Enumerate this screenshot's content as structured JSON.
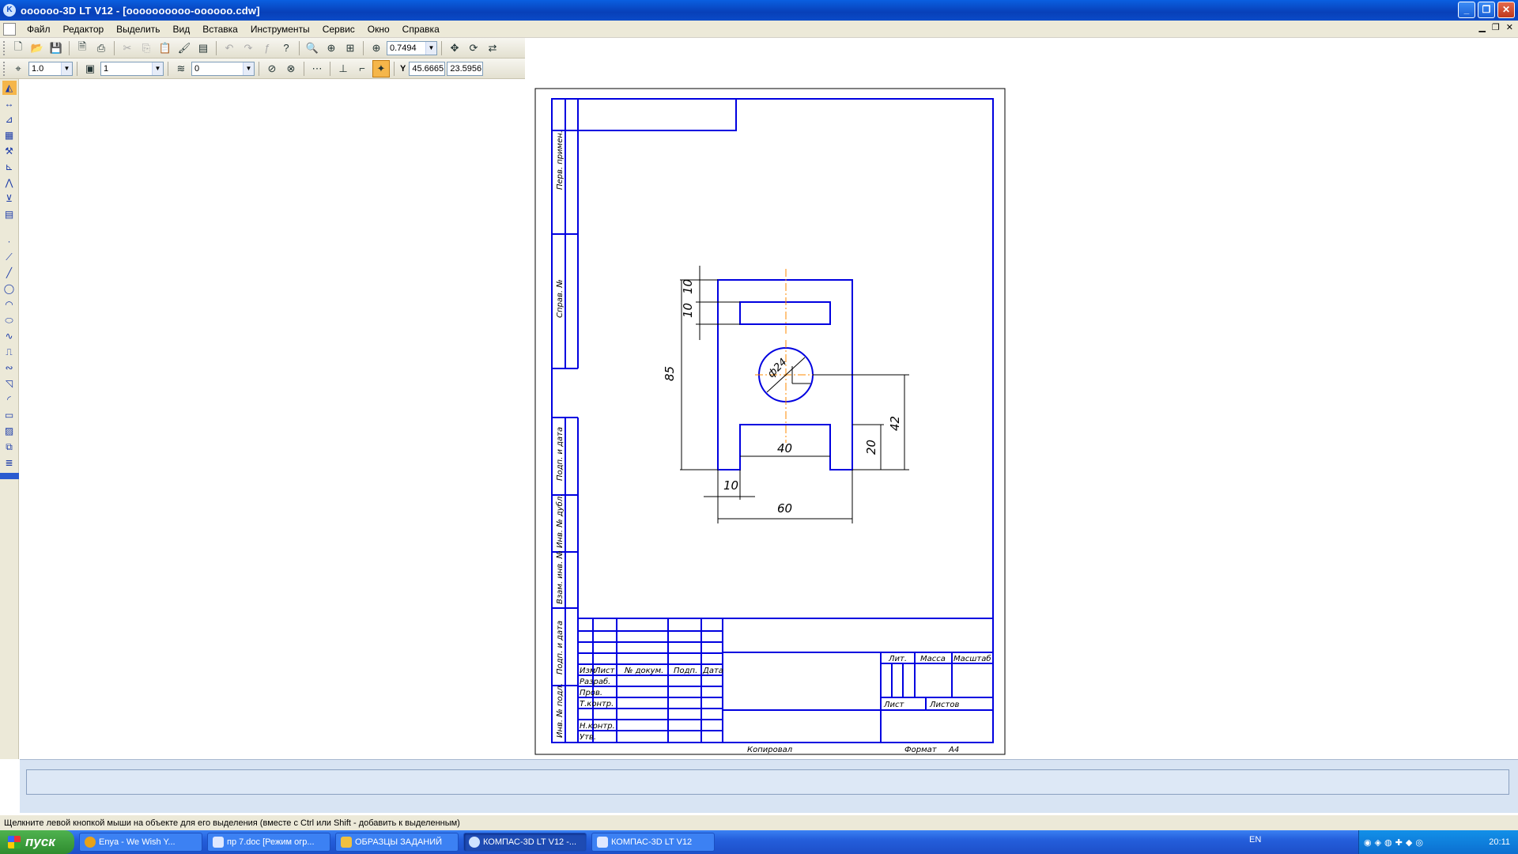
{
  "window": {
    "title": "oooooo-3D LT V12 - [oooooooooo-oooooo.cdw]"
  },
  "menu": [
    "Файл",
    "Редактор",
    "Выделить",
    "Вид",
    "Вставка",
    "Инструменты",
    "Сервис",
    "Окно",
    "Справка"
  ],
  "toolbar1": {
    "zoom": "0.7494"
  },
  "toolbar2": {
    "step": "1.0",
    "layer": "1",
    "style": "0",
    "coord_x": "45.6665",
    "coord_y": "23.5956",
    "coord_label": "Y"
  },
  "drawing": {
    "dims": {
      "d10a": "10",
      "d10b": "10",
      "d85": "85",
      "d42": "42",
      "d20": "20",
      "d40": "40",
      "d10c": "10",
      "d60": "60",
      "phi": "ф24"
    },
    "side_labels": [
      "Перв. примен.",
      "Справ. №",
      "Подп. и дата",
      "Инв. № дубл.",
      "Взам. инв. №",
      "Подп. и дата",
      "Инв. № подл."
    ],
    "stamp": {
      "izm": "Изм",
      "list": "Лист",
      "ndoc": "№ докум.",
      "podp": "Подп.",
      "data": "Дата",
      "razrab": "Разраб.",
      "prov": "Пров.",
      "tkontr": "Т.контр.",
      "nkontr": "Н.контр.",
      "utv": "Утв.",
      "lit": "Лит.",
      "massa": "Масса",
      "masshtab": "Масштаб",
      "list2": "Лист",
      "listov": "Листов",
      "kopiroval": "Копировал",
      "format": "Формат",
      "a4": "А4"
    }
  },
  "statusbar": {
    "text": "Щелкните левой кнопкой мыши на объекте для его выделения (вместе с Ctrl или Shift - добавить к выделенным)"
  },
  "taskbar": {
    "start": "пуск",
    "tasks": [
      "Enya - We Wish Y...",
      "пр 7.doc [Режим огр...",
      "ОБРАЗЦЫ ЗАДАНИЙ",
      "КОМПАС-3D LT V12 -...",
      "КОМПАС-3D LT V12"
    ],
    "lang": "EN",
    "time": "20:11"
  }
}
